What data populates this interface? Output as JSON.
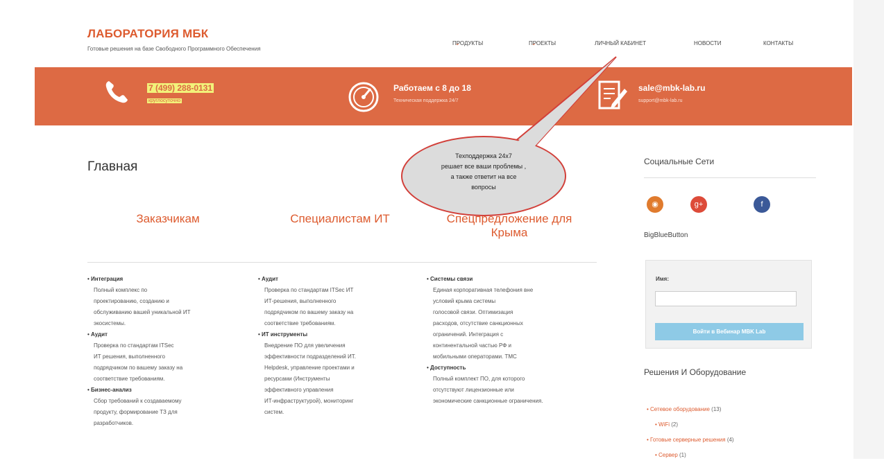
{
  "header": {
    "logo_title": "ЛАБОРАТОРИЯ МБК",
    "logo_subtitle": "Готовые решения на базе Свободного Программного Обеспечения"
  },
  "nav": {
    "items": [
      {
        "label": "ПРОДУКТЫ",
        "has_dropdown": true
      },
      {
        "label": "ПРОЕКТЫ",
        "has_dropdown": true
      },
      {
        "label": "ЛИЧНЫЙ КАБИНЕТ",
        "has_dropdown": false
      },
      {
        "label": "НОВОСТИ",
        "has_dropdown": false
      },
      {
        "label": "КОНТАКТЫ",
        "has_dropdown": false
      }
    ],
    "caret": "⌄"
  },
  "banner": {
    "color": "#dd6a44",
    "phone": {
      "main": "7 (499) 288-0131",
      "sub": "круглосуточно",
      "icon": "phone-icon"
    },
    "hours": {
      "main": "Работаем с 8 до 18",
      "sub": "Техническая поддержка 24/7",
      "icon": "speedometer-icon"
    },
    "email": {
      "main": "sale@mbk-lab.ru",
      "sub": "support@mbk-lab.ru",
      "icon": "edit-form-icon"
    }
  },
  "main": {
    "title": "Главная",
    "columns": [
      {
        "heading": "Заказчикам"
      },
      {
        "heading": "Специалистам ИТ"
      },
      {
        "heading": "Спецпредложение для Крыма"
      }
    ],
    "col1": {
      "items": [
        {
          "title": "Интеграция",
          "lines": [
            "Полный комплекс по",
            "проектированию, созданию и",
            "обслуживанию вашей уникальной ИТ",
            "экосистемы."
          ]
        },
        {
          "title": "Аудит",
          "lines": [
            "Проверка по стандартам ITSec",
            "ИТ решения, выполненного",
            "подрядчиком по вашему заказу на",
            "соответствие требованиям."
          ]
        },
        {
          "title": "Бизнес-анализ",
          "lines": [
            "Сбор требований к создаваемому",
            "продукту, формирование ТЗ для",
            "разработчиков."
          ]
        }
      ]
    },
    "col2": {
      "items": [
        {
          "title": "Аудит",
          "lines": [
            "Проверка по стандартам ITSec ИТ",
            "ИТ-решения, выполненного",
            "подрядчиком по вашему заказу на",
            "соответствие требованиям."
          ]
        },
        {
          "title": "ИТ инструменты",
          "lines": [
            "Внедрение ПО для увеличения",
            "эффективности подразделений ИТ.",
            "Helpdesk, управление проектами и",
            "ресурсами (Инструменты",
            "эффективного управления",
            "ИТ-инфраструктурой), мониторинг",
            "систем."
          ]
        }
      ]
    },
    "col3": {
      "items": [
        {
          "title": "Системы связи",
          "lines": [
            "Единая корпоративная телефония вне",
            "условий крыма системы",
            "голосовой связи. Оптимизация",
            "расходов, отсутствие санкционных",
            "ограничений. Интеграция с",
            "континентальной частью РФ и",
            "мобильными операторами. ТМС"
          ]
        },
        {
          "title": "Доступность",
          "lines": [
            "Полный комплект ПО, для которого",
            "отсутствуют лицензионные или",
            "экономические санкционные ограничения."
          ]
        }
      ]
    }
  },
  "callout": {
    "text_lines": [
      "Техподдержка 24x7",
      "решает все ваши проблемы ,",
      "а также ответит на все",
      "вопросы"
    ]
  },
  "sidebar": {
    "social_title": "Социальные Сети",
    "social": [
      {
        "icon": "rss-icon",
        "glyph": "◉",
        "color": "#e07b2e"
      },
      {
        "icon": "google-plus-icon",
        "glyph": "g+",
        "color": "#dd4b39"
      },
      {
        "icon": "facebook-icon",
        "glyph": "f",
        "color": "#3b5998"
      }
    ],
    "login_title": "BigBlueButton",
    "login_label": "Имя:",
    "login_button": "Войти в Вебинар MBK Lab",
    "solutions_title": "Решения И Оборудование",
    "solutions": [
      {
        "label": "Сетевое оборудование",
        "count": "(13)",
        "sub": false
      },
      {
        "label": "WiFi",
        "count": "(2)",
        "sub": true
      },
      {
        "label": "Готовые серверные решения",
        "count": "(4)",
        "sub": false
      },
      {
        "label": "Сервер",
        "count": "(1)",
        "sub": true
      }
    ]
  }
}
